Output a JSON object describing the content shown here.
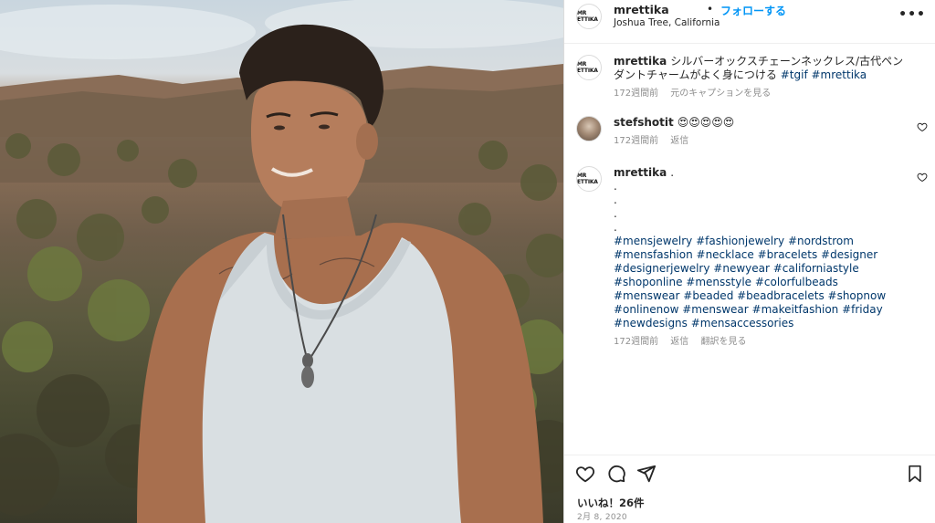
{
  "post": {
    "username": "mrettika",
    "follow_label": "フォローする",
    "separator": "•",
    "location": "Joshua Tree, California",
    "more_label": "•••",
    "avatar_logo": "MR ETTIKA"
  },
  "caption": {
    "username": "mrettika",
    "text": "シルバーオックスチェーンネックレス/古代ペンダントチャームがよく身につける",
    "tags": "#tgif #mrettika",
    "time": "172週間前",
    "see_original": "元のキャプションを見る"
  },
  "comments": [
    {
      "username": "stefshotit",
      "text": "😍😍😍😍😍",
      "time": "172週間前",
      "reply": "返信"
    },
    {
      "username": "mrettika",
      "text": ".",
      "dots": [
        ".",
        ".",
        ".",
        "."
      ],
      "hashtags": "#mensjewelry #fashionjewelry #nordstrom #mensfashion #necklace #bracelets #designer #designerjewelry #newyear #californiastyle #shoponline #mensstyle #colorfulbeads #menswear #beaded #beadbracelets #shopnow #onlinenow #menswear #makeitfashion #friday #newdesigns #mensaccessories",
      "time": "172週間前",
      "reply": "返信",
      "translate": "翻訳を見る"
    }
  ],
  "footer": {
    "likes": "いいね！26件",
    "date": "2月 8, 2020"
  },
  "icons": {
    "like": "heart-icon",
    "comment": "comment-icon",
    "share": "share-icon",
    "save": "bookmark-icon"
  }
}
